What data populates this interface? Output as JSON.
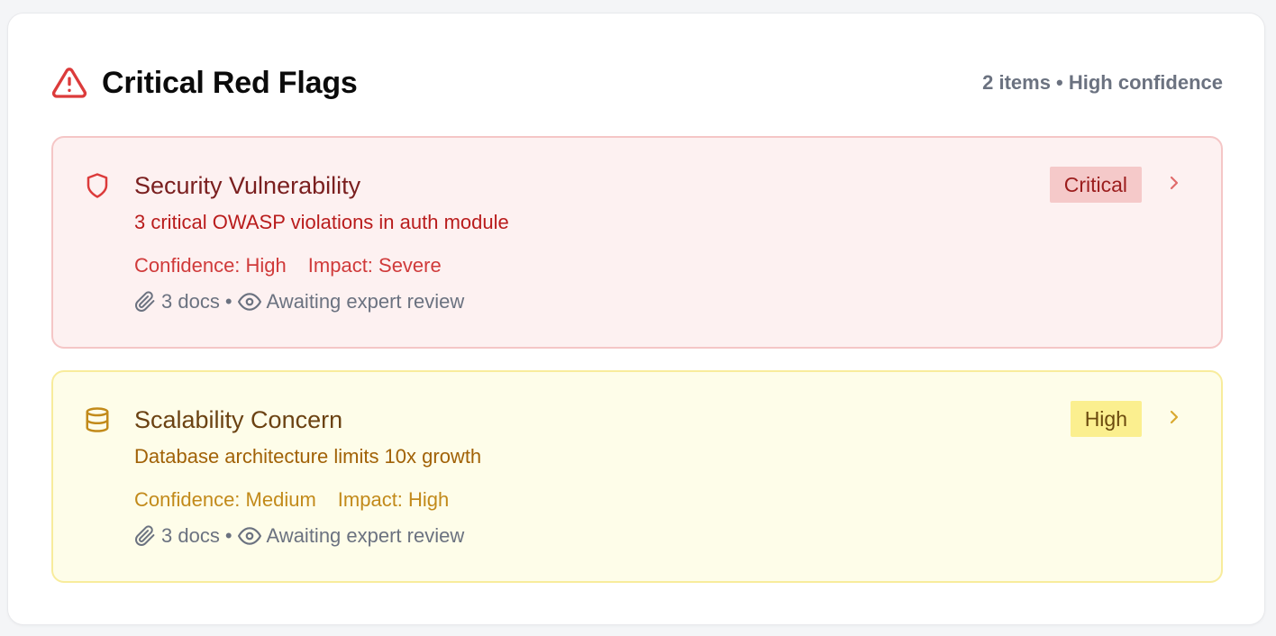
{
  "header": {
    "title": "Critical Red Flags",
    "icon": "alert-triangle-icon",
    "meta": "2 items • High confidence"
  },
  "colors": {
    "critical_accent": "#dc2626",
    "critical_bg": "#fdf1f1",
    "high_accent": "#ca8a04",
    "high_bg": "#fefde9"
  },
  "flags": [
    {
      "icon": "shield-icon",
      "title": "Security Vulnerability",
      "description": "3 critical OWASP violations in auth module",
      "confidence": "Confidence: High",
      "impact": "Impact: Severe",
      "badge": "Critical",
      "docs": "3 docs",
      "separator": "•",
      "review_status": "Awaiting expert review"
    },
    {
      "icon": "database-icon",
      "title": "Scalability Concern",
      "description": "Database architecture limits 10x growth",
      "confidence": "Confidence: Medium",
      "impact": "Impact: High",
      "badge": "High",
      "docs": "3 docs",
      "separator": "•",
      "review_status": "Awaiting expert review"
    }
  ]
}
